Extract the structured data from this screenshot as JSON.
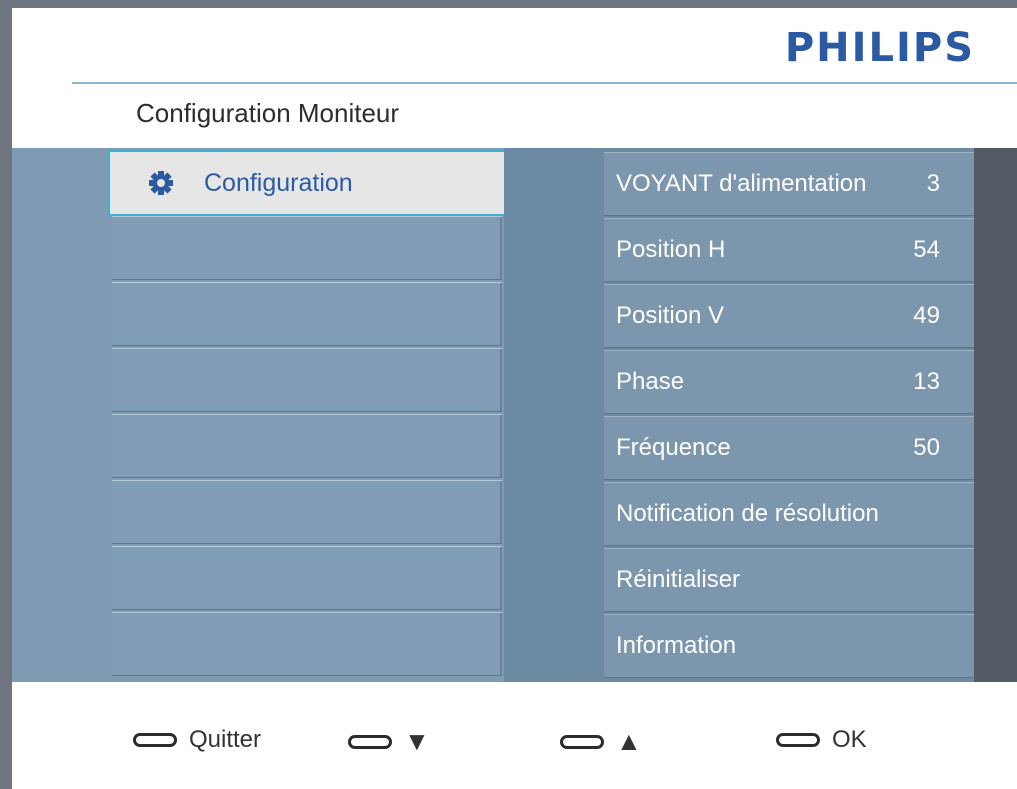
{
  "brand": "PHILIPS",
  "menu_title": "Configuration Moniteur",
  "left_menu": {
    "selected": {
      "label": "Configuration",
      "icon": "gear-icon"
    },
    "empty_rows": 7
  },
  "settings": [
    {
      "label": "VOYANT d'alimentation",
      "value": "3"
    },
    {
      "label": "Position H",
      "value": "54"
    },
    {
      "label": "Position V",
      "value": "49"
    },
    {
      "label": "Phase",
      "value": "13"
    },
    {
      "label": "Fréquence",
      "value": "50"
    },
    {
      "label": "Notification de résolution",
      "value": ""
    },
    {
      "label": "Réinitialiser",
      "value": ""
    },
    {
      "label": "Information",
      "value": ""
    }
  ],
  "footer": {
    "quit_label": "Quitter",
    "down_glyph": "▼",
    "up_glyph": "▲",
    "ok_label": "OK"
  },
  "colors": {
    "accent": "#2b5aa3",
    "selection_border": "#3fb1cf",
    "panel": "#7f9cb4",
    "dark_strip": "#525a64"
  }
}
